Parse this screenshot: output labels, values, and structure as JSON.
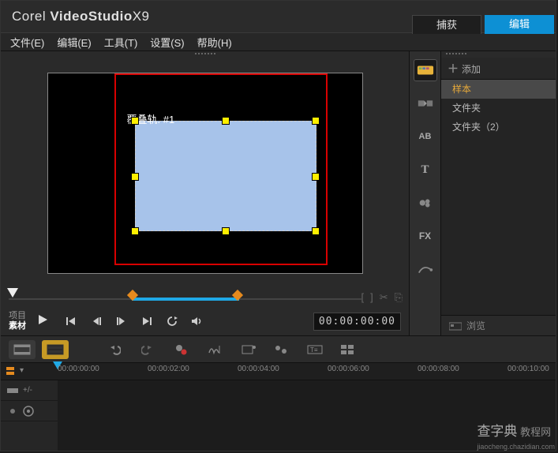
{
  "app": {
    "brand_prefix": "Corel",
    "brand_name": "VideoStudio",
    "brand_ver": "X9"
  },
  "top_tabs": {
    "capture": "捕获",
    "edit": "编辑"
  },
  "menu": {
    "file": "文件(E)",
    "edit": "编辑(E)",
    "tools": "工具(T)",
    "settings": "设置(S)",
    "help": "帮助(H)"
  },
  "preview": {
    "overlay_label": "覆叠轨. #1",
    "timecode": "00:00:00:00",
    "mode_project": "项目",
    "mode_clip": "素材"
  },
  "icons": {
    "bracket_open": "[",
    "bracket_close": "]",
    "scissors": "✂",
    "duplicate": "⎘"
  },
  "library": {
    "add": "添加",
    "items": [
      {
        "label": "样本"
      },
      {
        "label": "文件夹"
      },
      {
        "label": "文件夹（2）"
      }
    ],
    "browse": "浏览",
    "fx_label": "FX"
  },
  "timeline": {
    "ruler": [
      {
        "pos": 0,
        "label": "00:00:00:00"
      },
      {
        "pos": 114,
        "label": "00:00:02:00"
      },
      {
        "pos": 228,
        "label": "00:00:04:00"
      },
      {
        "pos": 342,
        "label": "00:00:06:00"
      },
      {
        "pos": 456,
        "label": "00:00:08:00"
      },
      {
        "pos": 570,
        "label": "00:00:10:00"
      }
    ]
  },
  "watermark": {
    "main": "查字典",
    "tag": "教程网",
    "url": "jiaocheng.chazidian.com"
  }
}
